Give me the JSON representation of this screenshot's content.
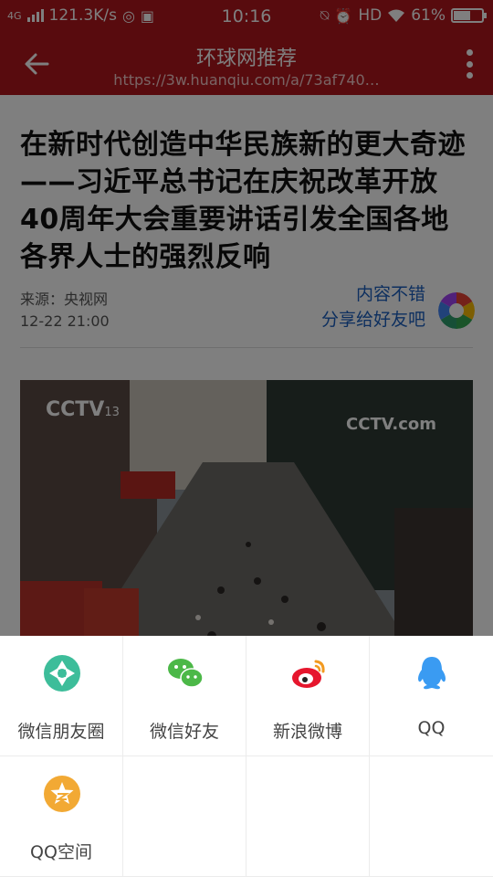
{
  "status_bar": {
    "network": "4G",
    "speed": "121.3K/s",
    "time": "10:16",
    "hd": "HD",
    "battery": "61%",
    "battery_level": 0.61
  },
  "header": {
    "title": "环球网推荐",
    "url": "https://3w.huanqiu.com/a/73af740…"
  },
  "article": {
    "headline": "在新时代创造中华民族新的更大奇迹——习近平总书记在庆祝改革开放40周年大会重要讲话引发全国各地各界人士的强烈反响",
    "source": "来源：央视网",
    "datetime": "12-22 21:00",
    "share_line1": "内容不错",
    "share_line2": "分享给好友吧",
    "photo_watermark_left": "CCTV",
    "photo_channel": "13",
    "photo_watermark_right": "CCTV.com"
  },
  "share_panel": {
    "items": [
      {
        "label": "微信朋友圈",
        "icon": "moments-icon",
        "color": "#3dbd9a"
      },
      {
        "label": "微信好友",
        "icon": "wechat-icon",
        "color": "#4cb848"
      },
      {
        "label": "新浪微博",
        "icon": "weibo-icon",
        "color": "#e6162d"
      },
      {
        "label": "QQ",
        "icon": "qq-icon",
        "color": "#3a9bf2"
      },
      {
        "label": "QQ空间",
        "icon": "qzone-icon",
        "color": "#f2a934"
      }
    ]
  },
  "colors": {
    "brand_red": "#b0161c",
    "link_blue": "#1a5fbf"
  }
}
